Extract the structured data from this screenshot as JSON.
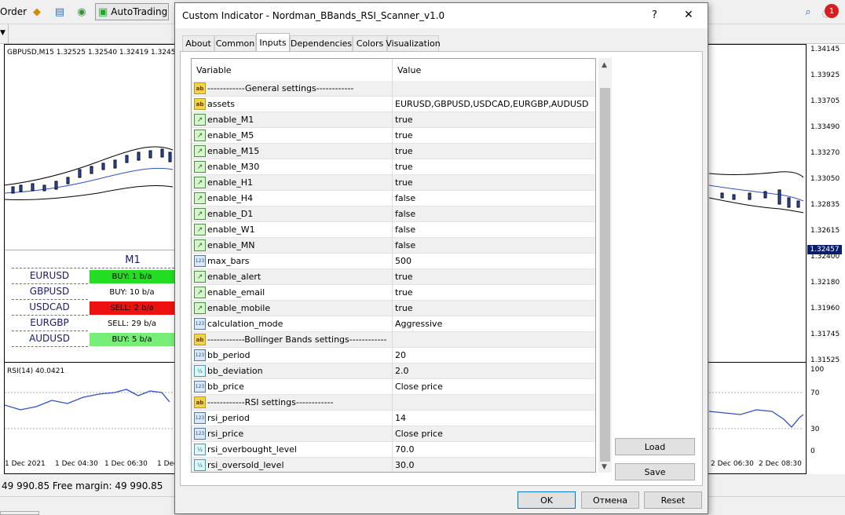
{
  "toolbar": {
    "order_label": "Order",
    "autotrading_label": "AutoTrading",
    "notification_count": "1"
  },
  "chart": {
    "header": "GBPUSD,M15  1.32525 1.32540 1.32419 1.3245",
    "price_axis": [
      "1.34145",
      "1.33925",
      "1.33705",
      "1.33490",
      "1.33270",
      "1.33050",
      "1.32835",
      "1.32615",
      "1.32457",
      "1.32400",
      "1.32180",
      "1.31960",
      "1.31745",
      "1.31525"
    ],
    "current_price": "1.32457",
    "rsi_label": "RSI(14) 40.0421",
    "rsi_axis": [
      "100",
      "70",
      "30",
      "0"
    ],
    "time_axis_left": [
      "1 Dec 2021",
      "1 Dec 04:30",
      "1 Dec 06:30",
      "1 Dec"
    ],
    "time_axis_right": [
      "2 Dec 06:30",
      "2 Dec 08:30"
    ],
    "scanner": {
      "timeframe": "M1",
      "rows": [
        {
          "symbol": "EURUSD",
          "signal": "BUY: 1 b/a",
          "color": "#22dd22"
        },
        {
          "symbol": "GBPUSD",
          "signal": "BUY: 10 b/a",
          "color": "#ffffff"
        },
        {
          "symbol": "USDCAD",
          "signal": "SELL: 2 b/a",
          "color": "#ee1111"
        },
        {
          "symbol": "EURGBP",
          "signal": "SELL: 29 b/a",
          "color": "#ffffff"
        },
        {
          "symbol": "AUDUSD",
          "signal": "BUY: 5 b/a",
          "color": "#77ee77"
        }
      ]
    }
  },
  "status": {
    "text": "49 990.85  Free margin: 49 990.85"
  },
  "dialog": {
    "title": "Custom Indicator - Nordman_BBands_RSI_Scanner_v1.0",
    "help_label": "?",
    "close_label": "✕",
    "tabs": [
      "About",
      "Common",
      "Inputs",
      "Dependencies",
      "Colors",
      "Visualization"
    ],
    "active_tab": "Inputs",
    "grid": {
      "col_variable": "Variable",
      "col_value": "Value",
      "rows": [
        {
          "type": "ab",
          "var": "------------General settings------------",
          "val": ""
        },
        {
          "type": "ab",
          "var": "assets",
          "val": "EURUSD,GBPUSD,USDCAD,EURGBP,AUDUSD"
        },
        {
          "type": "bool",
          "var": "enable_M1",
          "val": "true"
        },
        {
          "type": "bool",
          "var": "enable_M5",
          "val": "true"
        },
        {
          "type": "bool",
          "var": "enable_M15",
          "val": "true"
        },
        {
          "type": "bool",
          "var": "enable_M30",
          "val": "true"
        },
        {
          "type": "bool",
          "var": "enable_H1",
          "val": "true"
        },
        {
          "type": "bool",
          "var": "enable_H4",
          "val": "false"
        },
        {
          "type": "bool",
          "var": "enable_D1",
          "val": "false"
        },
        {
          "type": "bool",
          "var": "enable_W1",
          "val": "false"
        },
        {
          "type": "bool",
          "var": "enable_MN",
          "val": "false"
        },
        {
          "type": "int",
          "var": "max_bars",
          "val": "500"
        },
        {
          "type": "bool",
          "var": "enable_alert",
          "val": "true"
        },
        {
          "type": "bool",
          "var": "enable_email",
          "val": "true"
        },
        {
          "type": "bool",
          "var": "enable_mobile",
          "val": "true"
        },
        {
          "type": "int",
          "var": "calculation_mode",
          "val": "Aggressive"
        },
        {
          "type": "ab",
          "var": "------------Bollinger Bands settings------------",
          "val": ""
        },
        {
          "type": "int",
          "var": "bb_period",
          "val": "20"
        },
        {
          "type": "dbl",
          "var": "bb_deviation",
          "val": "2.0"
        },
        {
          "type": "int",
          "var": "bb_price",
          "val": "Close price"
        },
        {
          "type": "ab",
          "var": "------------RSI settings------------",
          "val": ""
        },
        {
          "type": "int",
          "var": "rsi_period",
          "val": "14"
        },
        {
          "type": "int",
          "var": "rsi_price",
          "val": "Close price"
        },
        {
          "type": "dbl",
          "var": "rsi_overbought_level",
          "val": "70.0"
        },
        {
          "type": "dbl",
          "var": "rsi_oversold_level",
          "val": "30.0"
        }
      ]
    },
    "buttons": {
      "load": "Load",
      "save": "Save",
      "ok": "OK",
      "cancel": "Отмена",
      "reset": "Reset"
    }
  }
}
